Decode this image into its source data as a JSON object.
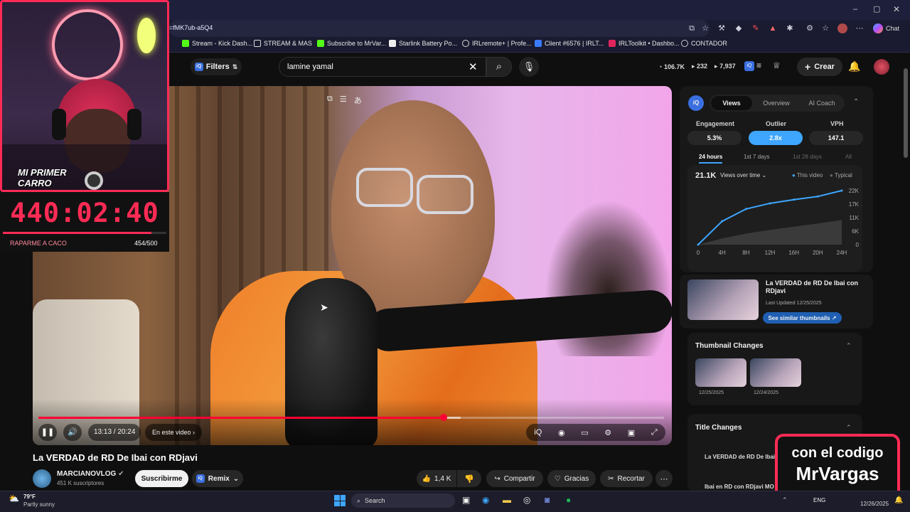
{
  "browser": {
    "url_fragment": "=fMK7ub-a5Q4",
    "bookmarks": [
      "Stream - Kick Dash...",
      "STREAM & MAS",
      "Subscribe to MrVar...",
      "Starlink Battery Po...",
      "IRLremote+ | Profe...",
      "Client #6576 | IRLT...",
      "IRLToolkit • Dashbo...",
      "CONTADOR"
    ],
    "chat_label": "Chat"
  },
  "yt": {
    "filters_label": "Filters",
    "search_value": "lamine yamal",
    "stats": {
      "views": "106.7K",
      "likes": "232",
      "comments": "7,937"
    },
    "create_label": "Crear"
  },
  "video": {
    "time": "13:13 / 20:24",
    "chapter": "En este video",
    "progress": 0.648,
    "buffered": 0.675,
    "title": "La VERDAD de RD De Ibai con RDjavi",
    "channel": "MARCIANOVLOG",
    "subscribers": "451 K suscriptores",
    "subscribe_label": "Suscribirme",
    "remix_label": "Remix",
    "likes": "1,4 K",
    "share_label": "Compartir",
    "thanks_label": "Gracias",
    "clip_label": "Recortar"
  },
  "panel": {
    "tabs": [
      "Views",
      "Overview",
      "AI Coach"
    ],
    "active_tab": "Views",
    "metrics": [
      {
        "label": "Engagement",
        "value": "5.3%"
      },
      {
        "label": "Outlier",
        "value": "2.8x"
      },
      {
        "label": "VPH",
        "value": "147.1"
      }
    ],
    "ranges": [
      "24 hours",
      "1st 7 days",
      "1st 28 days",
      "All"
    ],
    "active_range": "24 hours",
    "total": "21.1K",
    "dropdown": "Views over time",
    "legend": [
      "This video",
      "Typical"
    ],
    "related_title": "La VERDAD de RD De Ibai con RDjavi",
    "related_updated": "Last Updated 12/25/2025",
    "similar_label": "See similar thumbnails",
    "thumb_section": "Thumbnail Changes",
    "thumb_dates": [
      "12/25/2025",
      "12/24/2025"
    ],
    "title_section": "Title Changes",
    "title_items": [
      "La VERDAD de RD De Ibai",
      "Ibai en RD con RDjavi MO"
    ]
  },
  "chart_data": {
    "type": "area",
    "x": [
      "0",
      "4H",
      "8H",
      "12H",
      "16H",
      "20H",
      "24H"
    ],
    "series": [
      {
        "name": "This video",
        "values": [
          0,
          9500,
          14500,
          16800,
          18300,
          19600,
          22000
        ]
      },
      {
        "name": "Typical",
        "values": [
          0,
          2500,
          4500,
          6000,
          7300,
          8600,
          10000
        ]
      }
    ],
    "y_ticks": [
      "22K",
      "17K",
      "11K",
      "6K",
      "0"
    ],
    "ylim": [
      0,
      22000
    ],
    "colors": {
      "This video": "#3ea6ff",
      "Typical": "#555555"
    }
  },
  "overlay": {
    "cam_banner": "MI PRIMER CARRO",
    "timer": "440:02:40",
    "goal_label": "RAPARME A CACO",
    "goal_count": "454/500",
    "goal_progress": 0.908,
    "promo_line1": "con el codigo",
    "promo_line2": "MrVargas"
  },
  "taskbar": {
    "weather_temp": "79°F",
    "weather_desc": "Partly sunny",
    "search_label": "Search",
    "lang": "ENG",
    "date": "12/26/2025"
  }
}
